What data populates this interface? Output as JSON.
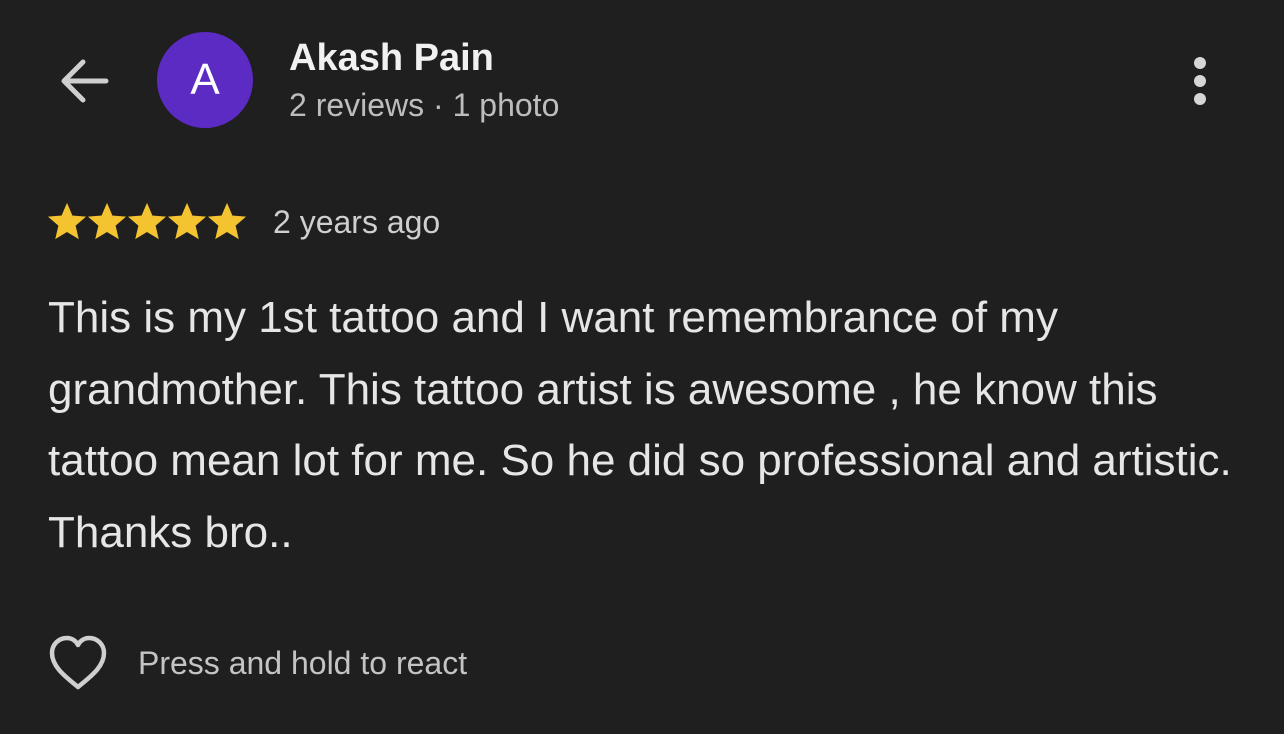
{
  "header": {
    "back_icon": "arrow-left-icon",
    "avatar_letter": "A",
    "avatar_color": "#5b2bc4",
    "author_name": "Akash Pain",
    "author_meta": "2 reviews · 1 photo",
    "more_icon": "more-vert-icon"
  },
  "review": {
    "rating": 5,
    "max_rating": 5,
    "star_color": "#f4c430",
    "date": "2 years ago",
    "text": "This is my 1st tattoo and I want remembrance of my grandmother. This tattoo artist is awesome , he know this tattoo mean lot for me. So he did so professional and artistic. Thanks bro.."
  },
  "reactions": {
    "icon": "heart-outline-icon",
    "label": "Press and hold to react"
  }
}
